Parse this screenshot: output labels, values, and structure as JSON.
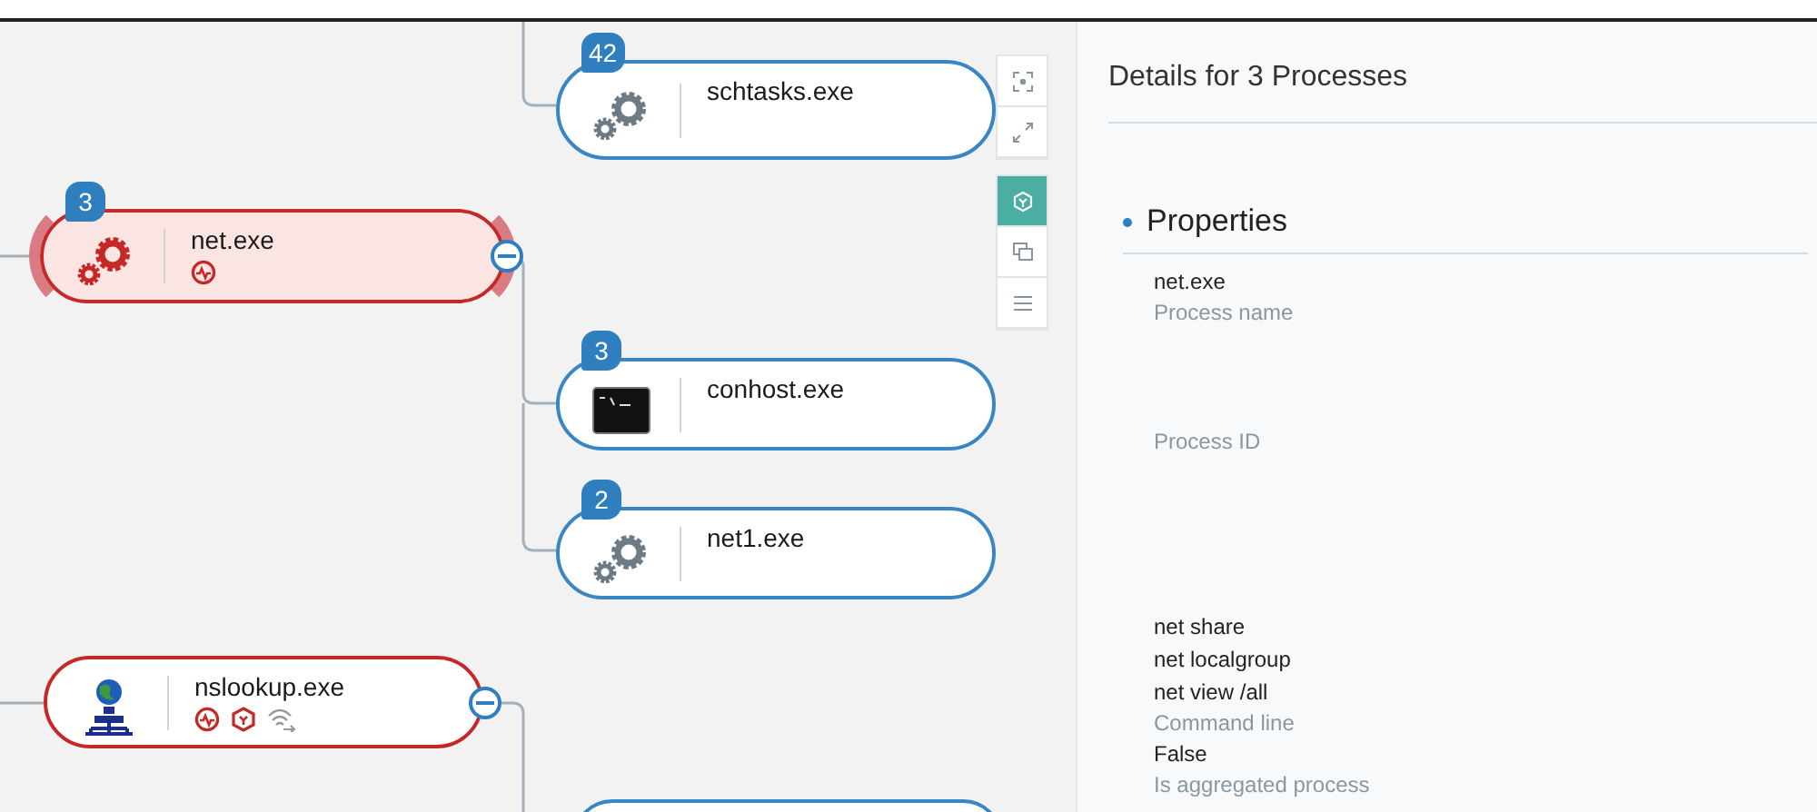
{
  "graph": {
    "nodes": [
      {
        "name": "schtasks.exe",
        "badge": "42",
        "kind": "gears",
        "selected": false,
        "flagged": false,
        "collapse_button": false
      },
      {
        "name": "net.exe",
        "badge": "3",
        "kind": "gears",
        "selected": true,
        "flagged": true,
        "collapse_button": true,
        "indicators": [
          {
            "kind": "pulse"
          }
        ]
      },
      {
        "name": "conhost.exe",
        "badge": "3",
        "kind": "console",
        "selected": false,
        "flagged": false,
        "collapse_button": false
      },
      {
        "name": "net1.exe",
        "badge": "2",
        "kind": "gears",
        "selected": false,
        "flagged": false,
        "collapse_button": false
      },
      {
        "name": "nslookup.exe",
        "kind": "network",
        "selected": false,
        "flagged": true,
        "collapse_button": true,
        "indicators": [
          {
            "kind": "pulse"
          },
          {
            "kind": "hexagon"
          },
          {
            "kind": "wireless"
          }
        ]
      }
    ]
  },
  "toolbar": [
    {
      "kind": "focus",
      "selected": false
    },
    {
      "kind": "expand",
      "selected": false
    },
    {
      "kind": "hexagon",
      "selected": true
    },
    {
      "kind": "copy",
      "selected": false
    },
    {
      "kind": "list",
      "selected": false
    }
  ],
  "details": {
    "title": "Details for 3 Processes",
    "section": "Properties",
    "properties": [
      {
        "values": [
          "net.exe"
        ],
        "label": "Process name"
      },
      {
        "label": "Process ID"
      },
      {
        "values": [
          "net share",
          "net localgroup",
          "net view /all"
        ],
        "label": "Command line"
      },
      {
        "values": [
          "False"
        ],
        "label": "Is aggregated process"
      }
    ]
  }
}
